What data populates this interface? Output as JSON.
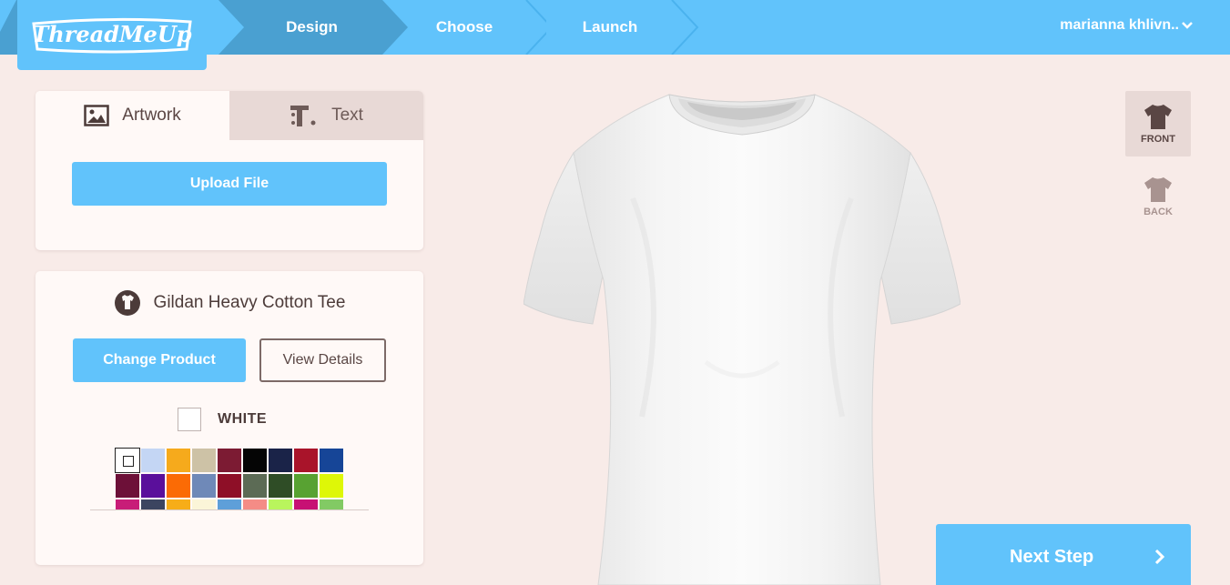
{
  "header": {
    "logo_text": "ThreadMeUp",
    "steps": [
      {
        "label": "Design",
        "active": true
      },
      {
        "label": "Choose",
        "active": false
      },
      {
        "label": "Launch",
        "active": false
      }
    ],
    "user_name": "marianna khlivn.."
  },
  "design_panel": {
    "tabs": [
      {
        "label": "Artwork",
        "icon": "image-icon",
        "active": true
      },
      {
        "label": "Text",
        "icon": "text-icon",
        "active": false
      }
    ],
    "upload_label": "Upload File"
  },
  "product_panel": {
    "product_name": "Gildan Heavy Cotton Tee",
    "change_label": "Change Product",
    "details_label": "View Details",
    "selected_color": "WHITE",
    "swatches": [
      "#ffffff",
      "#c4d6f4",
      "#f6aa1c",
      "#cdc2a6",
      "#7c1b33",
      "#050505",
      "#1a2348",
      "#a9142a",
      "#164597",
      "#6d1038",
      "#5a0f9b",
      "#fb6b05",
      "#6f89b8",
      "#8e0f27",
      "#5c6b55",
      "#2f4d26",
      "#58a232",
      "#def707",
      "#c81d78",
      "#3c4560",
      "#f7ad18",
      "#fbf5d8",
      "#5e9fd9",
      "#f48c86",
      "#b9f55d",
      "#c71174",
      "#82ca64"
    ]
  },
  "view_toggle": {
    "front_label": "FRONT",
    "back_label": "BACK"
  },
  "next_label": "Next Step",
  "colors": {
    "brand": "#61c3fb",
    "brand_dark": "#4aa0d1",
    "background": "#f8ebe8"
  }
}
